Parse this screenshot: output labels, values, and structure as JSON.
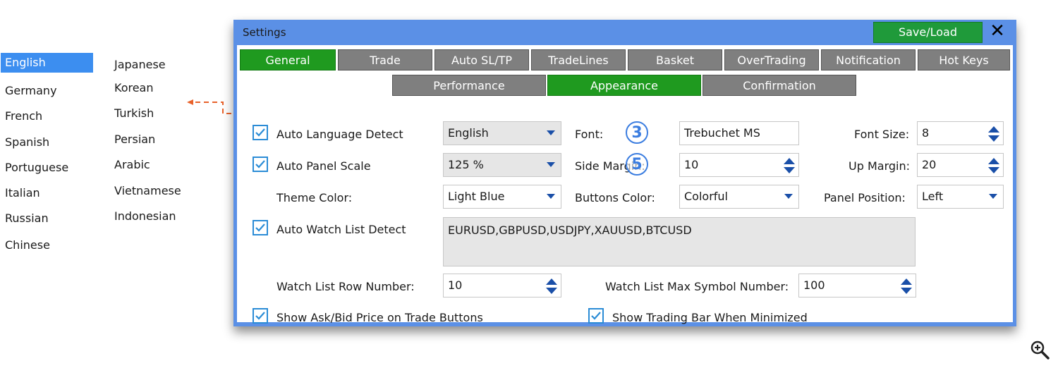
{
  "languages": {
    "col1": [
      "English",
      "Germany",
      "French",
      "Spanish",
      "Portuguese",
      "Italian",
      "Russian",
      "Chinese"
    ],
    "col2": [
      "Japanese",
      "Korean",
      "Turkish",
      "Persian",
      "Arabic",
      "Vietnamese",
      "Indonesian"
    ],
    "selected": "English"
  },
  "window": {
    "title": "Settings",
    "save_load": "Save/Load",
    "close_label": "✕"
  },
  "tabs_row1": [
    "General",
    "Trade",
    "Auto SL/TP",
    "TradeLines",
    "Basket",
    "OverTrading",
    "Notification",
    "Hot Keys"
  ],
  "tabs_row2": [
    "Performance",
    "Appearance",
    "Confirmation"
  ],
  "active_tab_row1": "General",
  "active_tab_row2": "Appearance",
  "appearance": {
    "auto_language_detect": {
      "label": "Auto Language Detect",
      "checked": true
    },
    "language_value": "English",
    "font_label": "Font:",
    "font_value": "Trebuchet MS",
    "font_size_label": "Font Size:",
    "font_size_value": "8",
    "auto_panel_scale": {
      "label": "Auto Panel Scale",
      "checked": true
    },
    "panel_scale_value": "125 %",
    "side_margin_label": "Side Margin:",
    "side_margin_value": "10",
    "up_margin_label": "Up Margin:",
    "up_margin_value": "20",
    "theme_color_label": "Theme Color:",
    "theme_color_value": "Light Blue",
    "buttons_color_label": "Buttons Color:",
    "buttons_color_value": "Colorful",
    "panel_position_label": "Panel Position:",
    "panel_position_value": "Left",
    "auto_watch_list": {
      "label": "Auto Watch List Detect",
      "checked": true
    },
    "watch_list_value": "EURUSD,GBPUSD,USDJPY,XAUUSD,BTCUSD",
    "row_number_label": "Watch List Row Number:",
    "row_number_value": "10",
    "max_symbol_label": "Watch List Max Symbol Number:",
    "max_symbol_value": "100",
    "show_ask_bid": {
      "label": "Show Ask/Bid Price on Trade Buttons",
      "checked": true
    },
    "show_trading_bar": {
      "label": "Show Trading Bar When Minimized",
      "checked": true
    }
  },
  "callouts": [
    "3",
    "5"
  ],
  "colors": {
    "window_frame": "#5b90e6",
    "tab_active": "#1f9a1f",
    "tab_inactive": "#7f7f7f",
    "save_button": "#1f9a3a",
    "selected_language": "#3c8ef0",
    "arrow": "#e8622b"
  }
}
